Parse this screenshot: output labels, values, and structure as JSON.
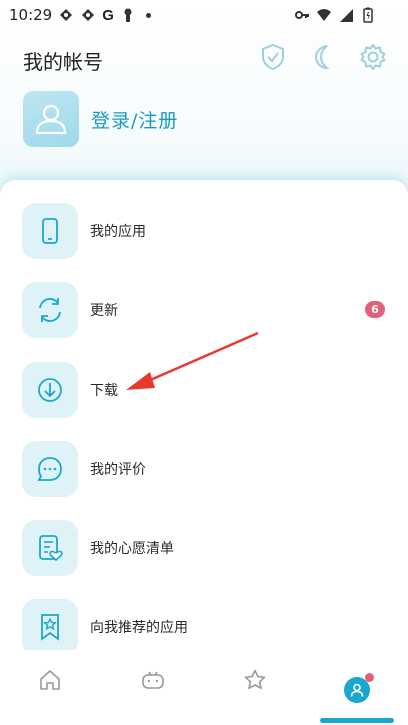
{
  "status_bar": {
    "time": "10:29",
    "g_letter": "G",
    "icons_left": [
      "game-controller-icon",
      "game-controller-icon",
      "g-icon",
      "keyhole-icon",
      "dot-icon"
    ],
    "icons_right": [
      "key-icon",
      "wifi-icon",
      "signal-icon",
      "battery-icon"
    ]
  },
  "header": {
    "title": "我的帐号",
    "icons": [
      "shield-check-icon",
      "moon-icon",
      "gear-icon"
    ]
  },
  "account": {
    "login_label": "登录/注册"
  },
  "menu": [
    {
      "label": "我的应用",
      "icon": "phone-icon"
    },
    {
      "label": "更新",
      "icon": "refresh-icon",
      "badge": "6"
    },
    {
      "label": "下载",
      "icon": "download-icon"
    },
    {
      "label": "我的评价",
      "icon": "comment-icon"
    },
    {
      "label": "我的心愿清单",
      "icon": "wishlist-icon"
    },
    {
      "label": "向我推荐的应用",
      "icon": "bookmark-star-icon"
    }
  ],
  "bottom_nav": [
    {
      "name": "home-icon",
      "active": false
    },
    {
      "name": "game-icon",
      "active": false
    },
    {
      "name": "star-icon",
      "active": false
    },
    {
      "name": "profile-icon",
      "active": true
    }
  ],
  "colors": {
    "accent": "#1aa7cf",
    "badge": "#e4607a",
    "icon_tile": "#dff2f8",
    "arrow": "#e8392f"
  }
}
